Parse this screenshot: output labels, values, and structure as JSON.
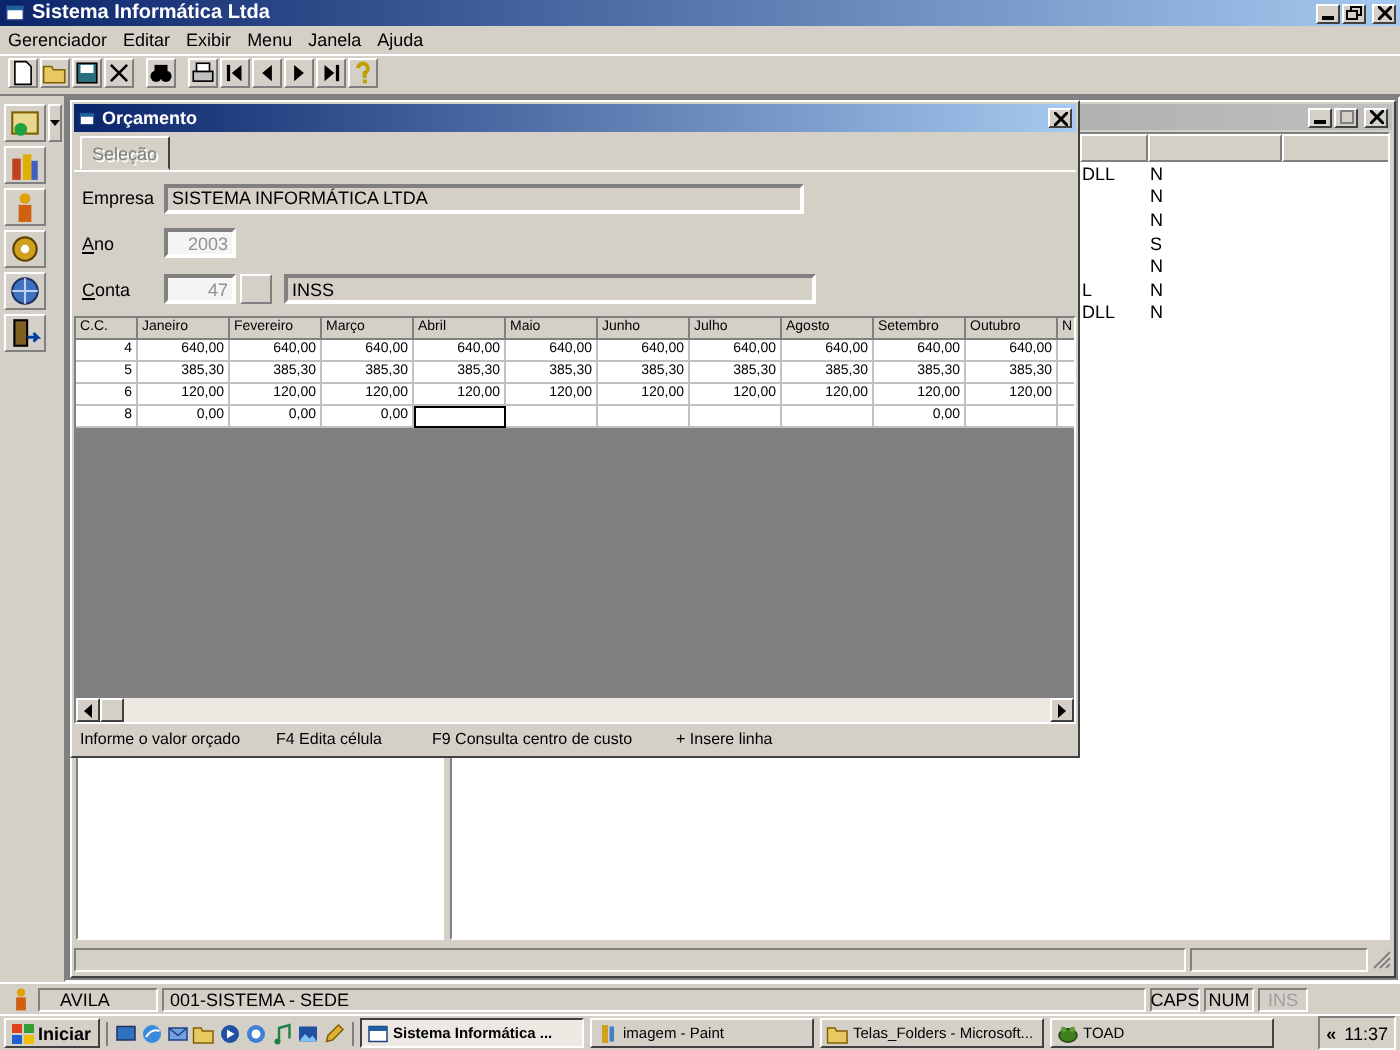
{
  "window": {
    "title": "Sistema Informática Ltda"
  },
  "menu": [
    "Gerenciador",
    "Editar",
    "Exibir",
    "Menu",
    "Janela",
    "Ajuda"
  ],
  "toolbar": [
    [
      {
        "kind": "new"
      },
      {
        "kind": "open"
      },
      {
        "kind": "save"
      },
      {
        "kind": "delete"
      }
    ],
    [
      {
        "kind": "find"
      }
    ],
    [
      {
        "kind": "print"
      },
      {
        "kind": "first"
      },
      {
        "kind": "prev"
      },
      {
        "kind": "next"
      },
      {
        "kind": "last"
      },
      {
        "kind": "help"
      }
    ]
  ],
  "side_toolbar": [
    {
      "kind": "wizard",
      "dropdown": true
    },
    {
      "kind": "people",
      "dropdown": false
    },
    {
      "kind": "person",
      "dropdown": false
    },
    {
      "kind": "gear",
      "dropdown": false
    },
    {
      "kind": "globe",
      "dropdown": false
    },
    {
      "kind": "exit",
      "dropdown": false
    }
  ],
  "background_window": {
    "rows": [
      {
        "column_1": "DLL",
        "column_2": "N"
      },
      {
        "column_2": "N"
      },
      {
        "column_2": "N"
      },
      {
        "column_2": "S"
      },
      {
        "column_2": "N"
      },
      {
        "column_1": "L",
        "column_2": "N"
      },
      {
        "column_1": "DLL",
        "column_2": "N"
      }
    ]
  },
  "budget_window": {
    "title": "Orçamento",
    "tabs": [
      {
        "label": "Seleção",
        "selected": true,
        "disabled": true
      }
    ],
    "fields": [
      {
        "kind": "text",
        "label": "Empresa",
        "mnemonic": false,
        "value": "SISTEMA INFORMÁTICA LTDA",
        "disabled": false
      },
      {
        "kind": "number",
        "label": "Ano",
        "mnemonic": true,
        "value": "2003",
        "disabled": true
      },
      {
        "kind": "lookup",
        "label": "Conta",
        "mnemonic": true,
        "value": "47",
        "description": "INSS",
        "disabled": true
      }
    ],
    "grid": {
      "columns": [
        "C.C.",
        "Janeiro",
        "Fevereiro",
        "Março",
        "Abril",
        "Maio",
        "Junho",
        "Julho",
        "Agosto",
        "Setembro",
        "Outubro",
        "N"
      ],
      "rows": [
        {
          "cc": "4",
          "values": [
            "640,00",
            "640,00",
            "640,00",
            "640,00",
            "640,00",
            "640,00",
            "640,00",
            "640,00",
            "640,00",
            "640,00"
          ]
        },
        {
          "cc": "5",
          "values": [
            "385,30",
            "385,30",
            "385,30",
            "385,30",
            "385,30",
            "385,30",
            "385,30",
            "385,30",
            "385,30",
            "385,30"
          ]
        },
        {
          "cc": "6",
          "values": [
            "120,00",
            "120,00",
            "120,00",
            "120,00",
            "120,00",
            "120,00",
            "120,00",
            "120,00",
            "120,00",
            "120,00"
          ]
        },
        {
          "cc": "8",
          "values": [
            {
              "text": "0,00",
              "editing": false
            },
            {
              "text": "0,00",
              "editing": false
            },
            {
              "text": "0,00",
              "editing": false
            },
            {
              "editing": true
            },
            {
              "editing": false
            },
            {
              "editing": false
            },
            {
              "editing": false
            },
            {
              "editing": false
            },
            {
              "text": "0,00",
              "editing": false
            },
            {
              "editing": false
            }
          ]
        }
      ]
    },
    "status": [
      "Informe o valor orçado",
      "F4 Edita célula",
      "F9 Consulta centro de custo",
      "+ Insere linha"
    ]
  },
  "status_bar": {
    "user": "AVILA",
    "company": "001-SISTEMA - SEDE",
    "indicators": [
      {
        "label": "CAPS",
        "on": true
      },
      {
        "label": "NUM",
        "on": true
      },
      {
        "label": "INS",
        "on": false
      }
    ]
  },
  "taskbar": {
    "start": "Iniciar",
    "quick_launch": [
      {
        "kind": "desktop"
      },
      {
        "kind": "browser"
      },
      {
        "kind": "mail"
      },
      {
        "kind": "folder"
      },
      {
        "kind": "media"
      },
      {
        "kind": "search"
      },
      {
        "kind": "music"
      },
      {
        "kind": "picture"
      },
      {
        "kind": "pencil"
      }
    ],
    "tasks": [
      {
        "kind": "app",
        "label": "Sistema Informática ...",
        "selected": true
      },
      {
        "kind": "paint",
        "label": "imagem - Paint",
        "selected": false
      },
      {
        "kind": "folder",
        "label": "Telas_Folders - Microsoft...",
        "selected": false
      },
      {
        "kind": "toad",
        "label": "TOAD",
        "selected": false
      }
    ],
    "tray": {
      "collapse": "«",
      "time": "11:37"
    }
  }
}
